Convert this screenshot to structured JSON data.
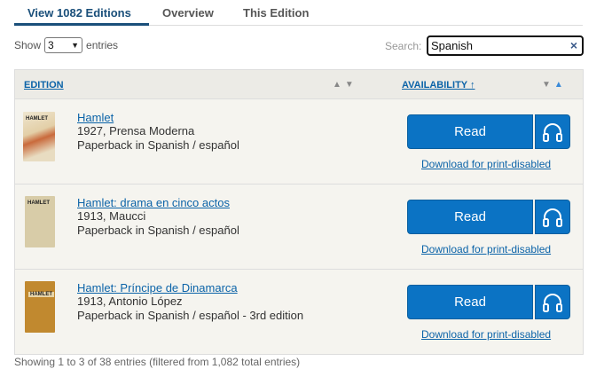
{
  "tabs": [
    {
      "label": "View 1082 Editions",
      "active": true
    },
    {
      "label": "Overview",
      "active": false
    },
    {
      "label": "This Edition",
      "active": false
    }
  ],
  "length_control": {
    "prefix": "Show",
    "selected": "3",
    "suffix": "entries"
  },
  "search": {
    "label": "Search:",
    "value": "Spanish",
    "clear_glyph": "×"
  },
  "columns": {
    "edition": "EDITION",
    "availability": "AVAILABILITY ↑"
  },
  "editions": [
    {
      "title": "Hamlet",
      "year_publisher": "1927, Prensa Moderna",
      "format": "Paperback in Spanish / español",
      "cover_text": "HAMLET",
      "read_label": "Read",
      "download_label": "Download for print-disabled"
    },
    {
      "title": "Hamlet: drama en cinco actos",
      "year_publisher": "1913, Maucci",
      "format": "Paperback in Spanish / español",
      "cover_text": "HAMLET",
      "read_label": "Read",
      "download_label": "Download for print-disabled"
    },
    {
      "title": "Hamlet: Príncipe de Dinamarca",
      "year_publisher": "1913, Antonio López",
      "format": "Paperback in Spanish / español - 3rd edition",
      "cover_text": "HAMLET",
      "read_label": "Read",
      "download_label": "Download for print-disabled"
    }
  ],
  "footer": {
    "info": "Showing 1 to 3 of 38 entries (filtered from 1,082 total entries)"
  },
  "colors": {
    "accent": "#0b73c4",
    "link": "#0b63a8",
    "tab_active": "#1a4f7a",
    "row_bg": "#f5f4ef"
  },
  "icons": {
    "listen": "headphones-icon",
    "sort": "sort-arrows-icon"
  }
}
